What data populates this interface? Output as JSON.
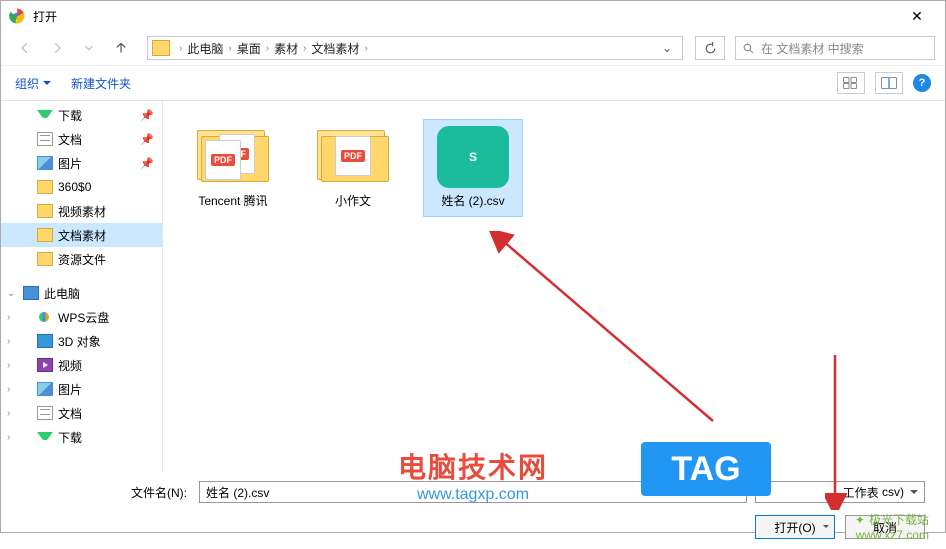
{
  "title": "打开",
  "breadcrumb": {
    "pc": "此电脑",
    "b1": "桌面",
    "b2": "素材",
    "b3": "文档素材"
  },
  "search": {
    "placeholder": "在 文档素材 中搜索"
  },
  "toolbar": {
    "organize": "组织",
    "newfolder": "新建文件夹"
  },
  "sidebar": {
    "downloads": "下载",
    "documents": "文档",
    "pictures": "图片",
    "f360": "360$0",
    "videoMat": "视频素材",
    "docMat": "文档素材",
    "resFiles": "资源文件",
    "thisPc": "此电脑",
    "wps": "WPS云盘",
    "obj3d": "3D 对象",
    "videos": "视频",
    "pictures2": "图片",
    "documents2": "文档",
    "downloads2": "下载"
  },
  "files": {
    "f1": "Tencent 腾讯",
    "f2": "小作文",
    "f3": "姓名 (2).csv",
    "pdf": "PDF",
    "sGlyph": "S"
  },
  "footer": {
    "filenameLabel": "文件名(N):",
    "filenameValue": "姓名 (2).csv",
    "filetype": "工作表",
    "filetypeExt": "csv)",
    "open": "打开(O)",
    "cancel": "取消"
  },
  "watermark": {
    "t1": "电脑技术网",
    "t2": "www.tagxp.com",
    "tag": "TAG",
    "t3": "极光下载站",
    "t4": "www.xz7.com"
  }
}
